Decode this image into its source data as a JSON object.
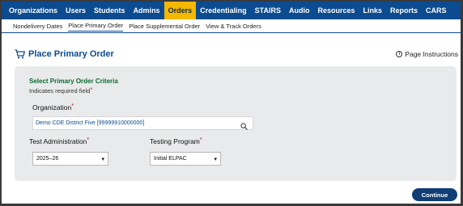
{
  "topnav": {
    "items": [
      "Organizations",
      "Users",
      "Students",
      "Admins",
      "Orders",
      "Credentialing",
      "STAIRS",
      "Audio",
      "Resources",
      "Links",
      "Reports",
      "CARS"
    ],
    "active": "Orders"
  },
  "subnav": {
    "items": [
      "Nondelivery Dates",
      "Place Primary Order",
      "Place Supplemental Order",
      "View & Track Orders"
    ],
    "active": "Place Primary Order"
  },
  "page": {
    "title": "Place Primary Order",
    "instructions": "Page Instructions"
  },
  "form": {
    "section_title": "Select Primary Order Criteria",
    "required_note": "Indicates required field",
    "required_mark": "*",
    "organization_label": "Organization",
    "organization_value": "Demo CDE District Five [99999910000000]",
    "test_admin_label": "Test Administration",
    "test_admin_value": "2025–26",
    "testing_program_label": "Testing Program",
    "testing_program_value": "Initial ELPAC"
  },
  "actions": {
    "continue_label": "Continue"
  },
  "colors": {
    "nav_bg": "#0c4b8f",
    "active_tab": "#f5b800",
    "section_title": "#0b6b2f",
    "button": "#103e75"
  },
  "icons": {
    "cart": "cart-icon",
    "info": "info-icon",
    "search": "search-icon",
    "dropdown": "chevron-down-icon"
  }
}
